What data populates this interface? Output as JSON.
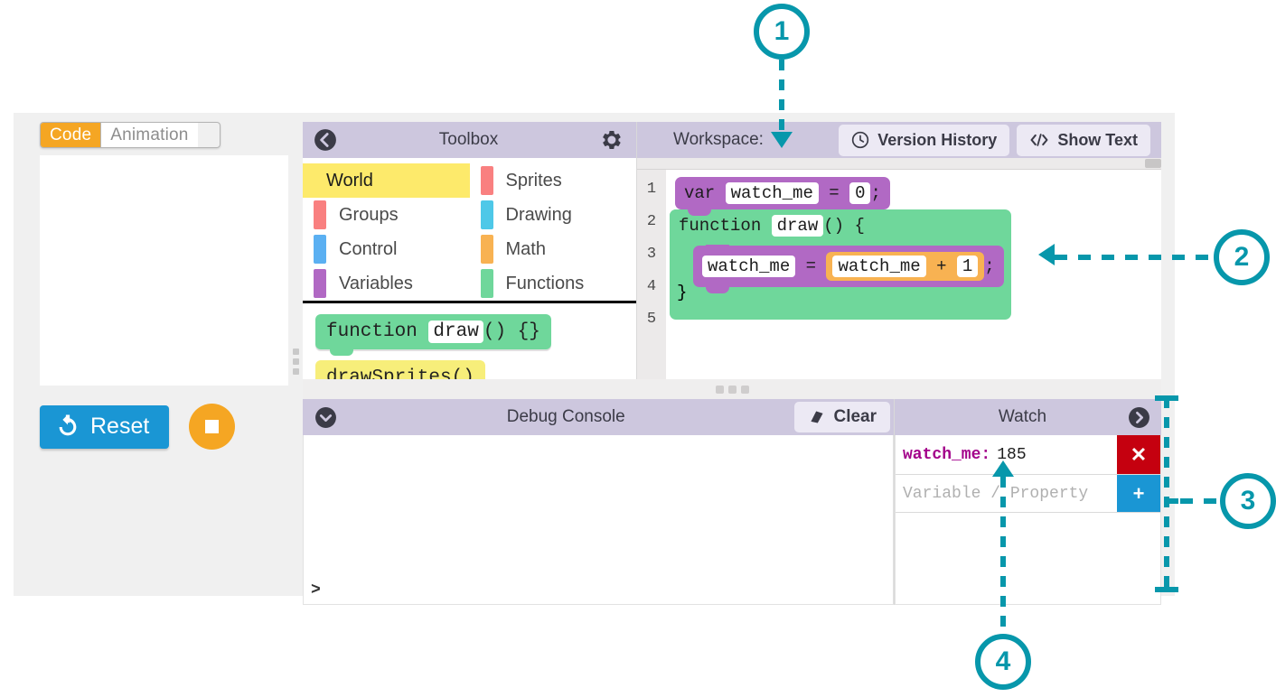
{
  "left_panel": {
    "tabs": [
      {
        "label": "Code",
        "active": true
      },
      {
        "label": "Animation",
        "active": false
      }
    ],
    "reset_label": "Reset",
    "stop_label": "",
    "reset_icon": "reset-circular-arrow-icon",
    "stop_icon": "stop-square-icon"
  },
  "toolbox": {
    "title": "Toolbox",
    "back_icon": "back-chevron-icon",
    "gear_icon": "gear-icon",
    "categories": [
      {
        "label": "World",
        "color": "#fdea6b",
        "selected": true
      },
      {
        "label": "Sprites",
        "color": "#f98080",
        "selected": false
      },
      {
        "label": "Groups",
        "color": "#f98080",
        "selected": false
      },
      {
        "label": "Drawing",
        "color": "#4ec8e8",
        "selected": false
      },
      {
        "label": "Control",
        "color": "#5bb0f2",
        "selected": false
      },
      {
        "label": "Math",
        "color": "#f8b252",
        "selected": false
      },
      {
        "label": "Variables",
        "color": "#b169c4",
        "selected": false
      },
      {
        "label": "Functions",
        "color": "#6fd79b",
        "selected": false
      }
    ],
    "blocks": [
      {
        "prefix": "function ",
        "field": "draw",
        "suffix": "() {}",
        "color": "#6fd79b"
      },
      {
        "prefix": "",
        "field": "",
        "suffix": "drawSprites()",
        "color": "#f7ee7a"
      }
    ]
  },
  "workspace": {
    "label": "Workspace:",
    "version_history_label": "Version History",
    "version_history_icon": "clock-icon",
    "show_text_label": "Show Text",
    "show_text_icon": "code-brackets-icon",
    "line_numbers": [
      "1",
      "2",
      "3",
      "4",
      "5"
    ],
    "code": {
      "line1": {
        "keyword": "var",
        "field": "watch_me",
        "op": "=",
        "value": "0",
        "end": ";",
        "color": "#b169c4"
      },
      "line2": {
        "keyword": "function",
        "field": "draw",
        "suffix": "() {",
        "color": "#6fd79b"
      },
      "line3": {
        "field": "watch_me",
        "op": "=",
        "expr_left": "watch_me",
        "expr_op": "+",
        "expr_right": "1",
        "end": ";",
        "color": "#b169c4",
        "expr_color": "#f8b252"
      },
      "line4": {
        "text": "}",
        "color": "#6fd79b"
      }
    }
  },
  "console": {
    "title": "Debug Console",
    "collapse_icon": "chevron-down-circle-icon",
    "clear_label": "Clear",
    "clear_icon": "eraser-icon",
    "prompt": ">"
  },
  "watch": {
    "title": "Watch",
    "expand_icon": "chevron-right-circle-icon",
    "entries": [
      {
        "name": "watch_me:",
        "value": "185",
        "remove_label": "✕"
      }
    ],
    "input_placeholder": "Variable / Property",
    "add_label": "+"
  },
  "callouts": [
    {
      "number": "1"
    },
    {
      "number": "2"
    },
    {
      "number": "3"
    },
    {
      "number": "4"
    }
  ],
  "colors": {
    "accent_teal": "#0797ab",
    "header_lavender": "#cdc7de",
    "tab_orange": "#f5a623",
    "button_blue": "#1a96d4",
    "remove_red": "#c5000f",
    "purple_block": "#b169c4",
    "green_block": "#6fd79b",
    "orange_block": "#f8b252",
    "yellow_block": "#fdea6b",
    "watch_name": "#a3008a"
  }
}
